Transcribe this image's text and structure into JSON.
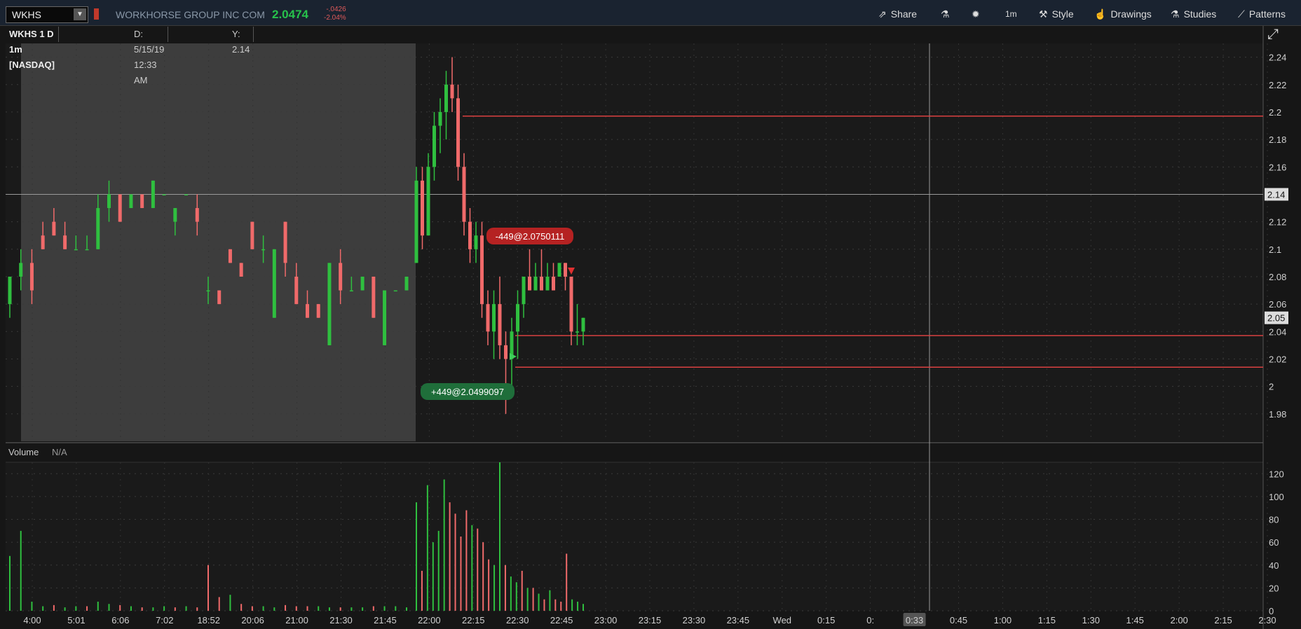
{
  "header": {
    "symbol": "WKHS",
    "company": "WORKHORSE GROUP INC COM",
    "last": "2.0474",
    "change": "-.0426",
    "change_pct": "-2.04%",
    "buttons": {
      "share": "Share",
      "interval": "1m",
      "style": "Style",
      "drawings": "Drawings",
      "studies": "Studies",
      "patterns": "Patterns"
    }
  },
  "subbar": {
    "title": "WKHS 1 D 1m [NASDAQ]",
    "date": "D: 5/15/19 12:33 AM",
    "y": "Y: 2.14"
  },
  "volume_panel": {
    "label": "Volume",
    "value": "N/A"
  },
  "colors": {
    "up": "#2fbf3f",
    "down": "#f06a6a",
    "level": "#d94040",
    "shade": "#3d3d3d",
    "bg": "#1a1a1a"
  },
  "chart_data": [
    {
      "type": "candlestick",
      "title": "WKHS 1 D 1m [NASDAQ]",
      "ylim": [
        1.96,
        2.25
      ],
      "y_ticks": [
        "1.98",
        "2",
        "2.02",
        "2.04",
        "2.06",
        "2.08",
        "2.1",
        "2.12",
        "2.14",
        "2.16",
        "2.18",
        "2.2",
        "2.22",
        "2.24"
      ],
      "x_ticks": [
        "4:00",
        "5:01",
        "6:06",
        "7:02",
        "18:52",
        "20:06",
        "21:00",
        "21:30",
        "21:45",
        "22:00",
        "22:15",
        "22:30",
        "22:45",
        "23:00",
        "23:15",
        "23:30",
        "23:45",
        "Wed",
        "0:15",
        "0:",
        "0:33",
        "0:45",
        "1:00",
        "1:15",
        "1:30",
        "1:45",
        "2:00",
        "2:15",
        "2:30"
      ],
      "crosshair_price": "2.14",
      "current_price_label": "2.05",
      "horizontal_levels": [
        2.197,
        2.037,
        2.014
      ],
      "crosshair_y": 2.14,
      "annotations": [
        {
          "text": "-449@2.0750111",
          "side": "sell"
        },
        {
          "text": "+449@2.0499097",
          "side": "buy"
        }
      ],
      "candles": [
        {
          "o": 2.06,
          "h": 2.08,
          "l": 2.05,
          "c": 2.08
        },
        {
          "o": 2.08,
          "h": 2.1,
          "l": 2.07,
          "c": 2.09
        },
        {
          "o": 2.09,
          "h": 2.1,
          "l": 2.06,
          "c": 2.07
        },
        {
          "o": 2.11,
          "h": 2.12,
          "l": 2.1,
          "c": 2.1
        },
        {
          "o": 2.12,
          "h": 2.13,
          "l": 2.11,
          "c": 2.11
        },
        {
          "o": 2.11,
          "h": 2.12,
          "l": 2.1,
          "c": 2.1
        },
        {
          "o": 2.1,
          "h": 2.11,
          "l": 2.1,
          "c": 2.1
        },
        {
          "o": 2.1,
          "h": 2.11,
          "l": 2.1,
          "c": 2.1
        },
        {
          "o": 2.1,
          "h": 2.14,
          "l": 2.1,
          "c": 2.13
        },
        {
          "o": 2.13,
          "h": 2.15,
          "l": 2.12,
          "c": 2.14
        },
        {
          "o": 2.14,
          "h": 2.14,
          "l": 2.12,
          "c": 2.12
        },
        {
          "o": 2.13,
          "h": 2.14,
          "l": 2.13,
          "c": 2.14
        },
        {
          "o": 2.14,
          "h": 2.14,
          "l": 2.13,
          "c": 2.13
        },
        {
          "o": 2.13,
          "h": 2.15,
          "l": 2.13,
          "c": 2.15
        },
        {
          "o": 2.14,
          "h": 2.14,
          "l": 2.14,
          "c": 2.14
        },
        {
          "o": 2.12,
          "h": 2.13,
          "l": 2.11,
          "c": 2.13
        },
        {
          "o": 2.14,
          "h": 2.14,
          "l": 2.14,
          "c": 2.14
        },
        {
          "o": 2.13,
          "h": 2.14,
          "l": 2.11,
          "c": 2.12
        },
        {
          "o": 2.07,
          "h": 2.08,
          "l": 2.06,
          "c": 2.07
        },
        {
          "o": 2.07,
          "h": 2.07,
          "l": 2.06,
          "c": 2.06
        },
        {
          "o": 2.1,
          "h": 2.1,
          "l": 2.09,
          "c": 2.09
        },
        {
          "o": 2.09,
          "h": 2.09,
          "l": 2.08,
          "c": 2.08
        },
        {
          "o": 2.12,
          "h": 2.12,
          "l": 2.1,
          "c": 2.1
        },
        {
          "o": 2.1,
          "h": 2.11,
          "l": 2.09,
          "c": 2.1
        },
        {
          "o": 2.05,
          "h": 2.1,
          "l": 2.05,
          "c": 2.1
        },
        {
          "o": 2.12,
          "h": 2.12,
          "l": 2.08,
          "c": 2.09
        },
        {
          "o": 2.08,
          "h": 2.09,
          "l": 2.06,
          "c": 2.06
        },
        {
          "o": 2.06,
          "h": 2.07,
          "l": 2.05,
          "c": 2.05
        },
        {
          "o": 2.06,
          "h": 2.06,
          "l": 2.05,
          "c": 2.05
        },
        {
          "o": 2.03,
          "h": 2.09,
          "l": 2.03,
          "c": 2.09
        },
        {
          "o": 2.09,
          "h": 2.1,
          "l": 2.06,
          "c": 2.07
        },
        {
          "o": 2.07,
          "h": 2.08,
          "l": 2.07,
          "c": 2.07
        },
        {
          "o": 2.07,
          "h": 2.08,
          "l": 2.07,
          "c": 2.08
        },
        {
          "o": 2.08,
          "h": 2.08,
          "l": 2.05,
          "c": 2.05
        },
        {
          "o": 2.03,
          "h": 2.07,
          "l": 2.03,
          "c": 2.07
        },
        {
          "o": 2.07,
          "h": 2.07,
          "l": 2.07,
          "c": 2.07
        },
        {
          "o": 2.07,
          "h": 2.08,
          "l": 2.07,
          "c": 2.08
        },
        {
          "o": 2.09,
          "h": 2.16,
          "l": 2.09,
          "c": 2.15
        },
        {
          "o": 2.15,
          "h": 2.16,
          "l": 2.1,
          "c": 2.11
        },
        {
          "o": 2.11,
          "h": 2.17,
          "l": 2.11,
          "c": 2.16
        },
        {
          "o": 2.16,
          "h": 2.2,
          "l": 2.15,
          "c": 2.19
        },
        {
          "o": 2.19,
          "h": 2.21,
          "l": 2.17,
          "c": 2.2
        },
        {
          "o": 2.2,
          "h": 2.23,
          "l": 2.18,
          "c": 2.22
        },
        {
          "o": 2.22,
          "h": 2.24,
          "l": 2.2,
          "c": 2.21
        },
        {
          "o": 2.21,
          "h": 2.22,
          "l": 2.15,
          "c": 2.16
        },
        {
          "o": 2.16,
          "h": 2.17,
          "l": 2.11,
          "c": 2.12
        },
        {
          "o": 2.12,
          "h": 2.13,
          "l": 2.09,
          "c": 2.1
        },
        {
          "o": 2.1,
          "h": 2.12,
          "l": 2.09,
          "c": 2.11
        },
        {
          "o": 2.11,
          "h": 2.12,
          "l": 2.05,
          "c": 2.06
        },
        {
          "o": 2.06,
          "h": 2.07,
          "l": 2.03,
          "c": 2.04
        },
        {
          "o": 2.04,
          "h": 2.07,
          "l": 2.02,
          "c": 2.06
        },
        {
          "o": 2.06,
          "h": 2.08,
          "l": 2.02,
          "c": 2.03
        },
        {
          "o": 2.03,
          "h": 2.04,
          "l": 1.98,
          "c": 2.02
        },
        {
          "o": 2.02,
          "h": 2.05,
          "l": 2.0,
          "c": 2.04
        },
        {
          "o": 2.04,
          "h": 2.07,
          "l": 2.02,
          "c": 2.06
        },
        {
          "o": 2.06,
          "h": 2.08,
          "l": 2.05,
          "c": 2.08
        },
        {
          "o": 2.08,
          "h": 2.1,
          "l": 2.07,
          "c": 2.07
        },
        {
          "o": 2.07,
          "h": 2.09,
          "l": 2.07,
          "c": 2.08
        },
        {
          "o": 2.08,
          "h": 2.1,
          "l": 2.07,
          "c": 2.07
        },
        {
          "o": 2.07,
          "h": 2.09,
          "l": 2.07,
          "c": 2.08
        },
        {
          "o": 2.08,
          "h": 2.09,
          "l": 2.07,
          "c": 2.07
        },
        {
          "o": 2.08,
          "h": 2.09,
          "l": 2.08,
          "c": 2.09
        },
        {
          "o": 2.09,
          "h": 2.09,
          "l": 2.07,
          "c": 2.08
        },
        {
          "o": 2.08,
          "h": 2.08,
          "l": 2.03,
          "c": 2.04
        },
        {
          "o": 2.04,
          "h": 2.06,
          "l": 2.03,
          "c": 2.04
        },
        {
          "o": 2.04,
          "h": 2.05,
          "l": 2.03,
          "c": 2.05
        }
      ]
    },
    {
      "type": "bar",
      "title": "Volume",
      "ylim": [
        0,
        130
      ],
      "y_ticks": [
        "0",
        "20",
        "40",
        "60",
        "80",
        "100",
        "120"
      ],
      "values": [
        48,
        70,
        8,
        4,
        5,
        3,
        4,
        4,
        8,
        6,
        5,
        4,
        3,
        3,
        4,
        3,
        4,
        3,
        40,
        12,
        14,
        6,
        4,
        4,
        3,
        5,
        4,
        4,
        4,
        3,
        3,
        3,
        3,
        4,
        4,
        4,
        3,
        95,
        35,
        110,
        60,
        70,
        115,
        95,
        85,
        65,
        88,
        75,
        72,
        60,
        45,
        40,
        130,
        40,
        30,
        25,
        35,
        20,
        20,
        15,
        10,
        18,
        10,
        8,
        50,
        10,
        8,
        6
      ],
      "up": [
        1,
        1,
        1,
        1,
        0,
        1,
        1,
        0,
        1,
        1,
        0,
        1,
        0,
        1,
        1,
        0,
        1,
        0,
        0,
        0,
        1,
        0,
        0,
        1,
        1,
        0,
        0,
        0,
        1,
        1,
        0,
        1,
        1,
        0,
        1,
        1,
        1,
        1,
        0,
        1,
        1,
        1,
        1,
        0,
        0,
        0,
        0,
        1,
        0,
        0,
        0,
        1,
        1,
        0,
        1,
        1,
        0,
        1,
        0,
        1,
        0,
        1,
        0,
        0,
        0,
        1,
        1,
        1
      ]
    }
  ]
}
